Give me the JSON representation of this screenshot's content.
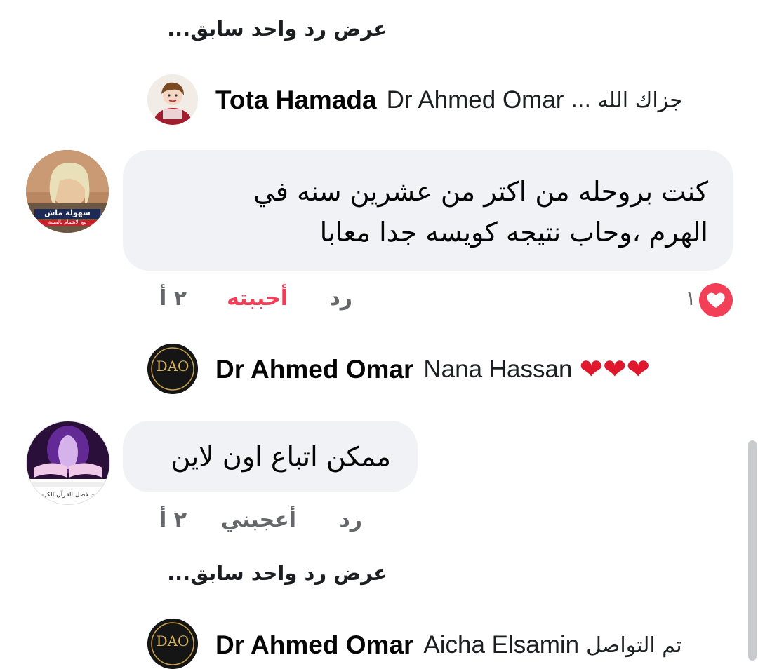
{
  "view_previous_top": "عرض رد واحد سابق...",
  "reply_tota": {
    "name": "Tota Hamada",
    "tag": "Dr Ahmed Omar",
    "text": "جزاك الله ..."
  },
  "comment_nana": {
    "text_line1": "كنت بروحله من اكتر من عشرين سنه في",
    "text_line2": "الهرم ،وحاب نتيجه كويسه جدا معابا",
    "time": "٢ أ",
    "like_action": "أحببته",
    "reply_action": "رد",
    "reaction_count": "١",
    "avatar_banner": "سهولة ماش",
    "avatar_caption": "مع الاهتمام بالمسة"
  },
  "reply_dr_1": {
    "name": "Dr Ahmed Omar",
    "tag": "Nana Hassan",
    "text": "❤❤❤"
  },
  "comment_2": {
    "text": "ممكن اتباع اون لاين",
    "time": "٢ أ",
    "like_action": "أعجبني",
    "reply_action": "رد",
    "avatar_caption": "من فضل القرآن الكريم"
  },
  "view_previous_bottom": "عرض رد واحد سابق...",
  "reply_dr_2": {
    "name": "Dr Ahmed Omar",
    "tag": "Aicha Elsamin",
    "text": "تم التواصل"
  },
  "logo_text": "DAO",
  "colors": {
    "bubble": "#f0f2f5",
    "liked": "#f33e58",
    "meta": "#65676b"
  }
}
